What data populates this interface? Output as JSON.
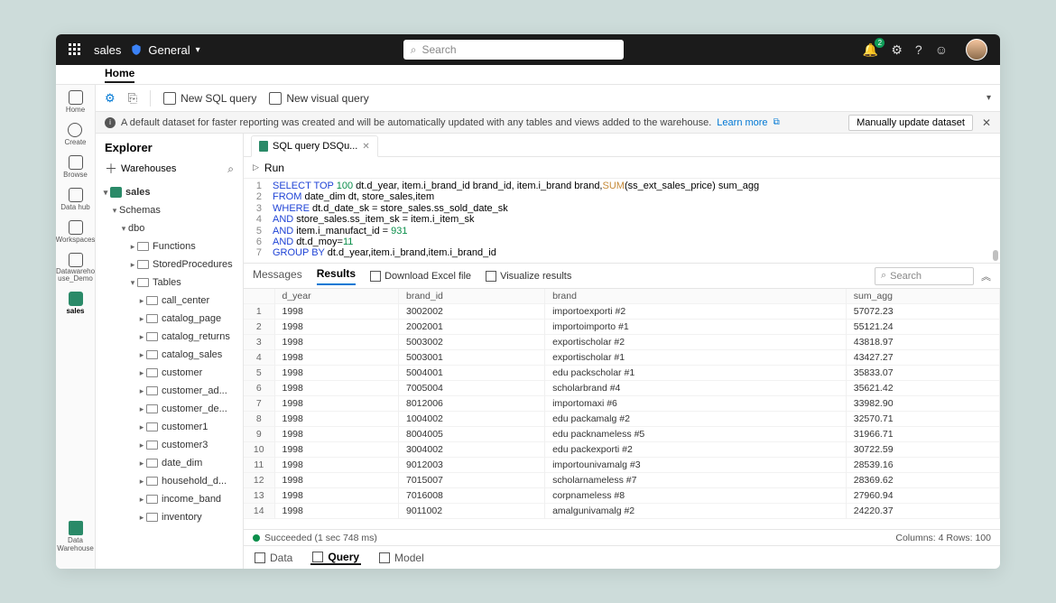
{
  "header": {
    "workspace_name": "sales",
    "workspace_type": "General",
    "search_placeholder": "Search",
    "notification_count": "2"
  },
  "breadcrumb": {
    "home": "Home"
  },
  "left_rail": {
    "items": [
      "Home",
      "Create",
      "Browse",
      "Data hub",
      "Workspaces",
      "Datawareho\nuse_Demo",
      "sales"
    ],
    "bottom": "Data Warehouse"
  },
  "toolbar": {
    "new_sql": "New SQL query",
    "new_visual": "New visual query"
  },
  "banner": {
    "text": "A default dataset for faster reporting was created and will be automatically updated with any tables and views added to the warehouse.",
    "learn_more": "Learn more",
    "manual_btn": "Manually update dataset"
  },
  "explorer": {
    "title": "Explorer",
    "add_label": "Warehouses",
    "tree": {
      "db": "sales",
      "schemas": "Schemas",
      "dbo": "dbo",
      "functions": "Functions",
      "stored_procedures": "StoredProcedures",
      "tables": "Tables",
      "table_list": [
        "call_center",
        "catalog_page",
        "catalog_returns",
        "catalog_sales",
        "customer",
        "customer_ad...",
        "customer_de...",
        "customer1",
        "customer3",
        "date_dim",
        "household_d...",
        "income_band",
        "inventory"
      ]
    }
  },
  "editor": {
    "tab_name": "SQL query DSQu...",
    "run": "Run",
    "code_lines": [
      "SELECT TOP 100 dt.d_year, item.i_brand_id brand_id, item.i_brand brand,SUM(ss_ext_sales_price) sum_agg",
      "FROM date_dim dt, store_sales,item",
      "WHERE dt.d_date_sk = store_sales.ss_sold_date_sk",
      "AND store_sales.ss_item_sk = item.i_item_sk",
      "AND item.i_manufact_id = 931",
      "AND dt.d_moy=11",
      "GROUP BY dt.d_year,item.i_brand,item.i_brand_id"
    ]
  },
  "results": {
    "tabs": {
      "messages": "Messages",
      "results": "Results"
    },
    "download": "Download Excel file",
    "visualize": "Visualize results",
    "search_placeholder": "Search",
    "columns": [
      "d_year",
      "brand_id",
      "brand",
      "sum_agg"
    ],
    "rows": [
      [
        "1998",
        "3002002",
        "importoexporti #2",
        "57072.23"
      ],
      [
        "1998",
        "2002001",
        "importoimporto #1",
        "55121.24"
      ],
      [
        "1998",
        "5003002",
        "exportischolar #2",
        "43818.97"
      ],
      [
        "1998",
        "5003001",
        "exportischolar #1",
        "43427.27"
      ],
      [
        "1998",
        "5004001",
        "edu packscholar #1",
        "35833.07"
      ],
      [
        "1998",
        "7005004",
        "scholarbrand #4",
        "35621.42"
      ],
      [
        "1998",
        "8012006",
        "importomaxi #6",
        "33982.90"
      ],
      [
        "1998",
        "1004002",
        "edu packamalg #2",
        "32570.71"
      ],
      [
        "1998",
        "8004005",
        "edu packnameless #5",
        "31966.71"
      ],
      [
        "1998",
        "3004002",
        "edu packexporti #2",
        "30722.59"
      ],
      [
        "1998",
        "9012003",
        "importounivamalg #3",
        "28539.16"
      ],
      [
        "1998",
        "7015007",
        "scholarnameless #7",
        "28369.62"
      ],
      [
        "1998",
        "7016008",
        "corpnameless #8",
        "27960.94"
      ],
      [
        "1998",
        "9011002",
        "amalgunivamalg #2",
        "24220.37"
      ]
    ]
  },
  "status": {
    "succeeded": "Succeeded (1 sec 748 ms)",
    "cols_rows": "Columns: 4 Rows: 100"
  },
  "bottom_tabs": {
    "data": "Data",
    "query": "Query",
    "model": "Model"
  }
}
